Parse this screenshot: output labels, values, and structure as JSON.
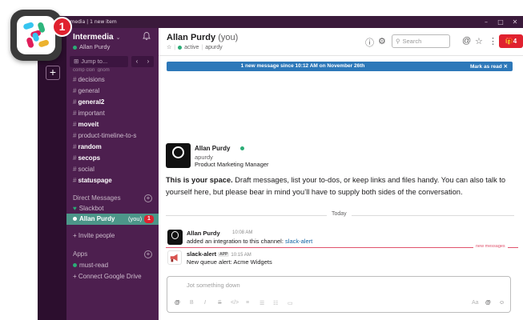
{
  "window": {
    "title": "ck | Intermedia | 1 new item",
    "controls": {
      "minimize": "–",
      "maximize": "□",
      "close": "✕"
    }
  },
  "app_icon": {
    "badge": "1",
    "icon": "slack-logo-icon"
  },
  "team_rail": {
    "add": "+"
  },
  "sidebar": {
    "team_name": "Intermedia",
    "team_caret": "⌄",
    "user": "Allan Purdy",
    "jump_to": "Jump to...",
    "channels_clipped": "comp clon_gnom",
    "channels": [
      {
        "label": "decisions",
        "bold": false
      },
      {
        "label": "general",
        "bold": false
      },
      {
        "label": "general2",
        "bold": true
      },
      {
        "label": "important",
        "bold": false
      },
      {
        "label": "moveit",
        "bold": true
      },
      {
        "label": "product-timeline-to-s",
        "bold": false
      },
      {
        "label": "random",
        "bold": true
      },
      {
        "label": "secops",
        "bold": true
      },
      {
        "label": "social",
        "bold": false
      },
      {
        "label": "statuspage",
        "bold": true
      }
    ],
    "dm_header": "Direct Messages",
    "dm_slackbot": "Slackbot",
    "dm_active": {
      "name": "Allan Purdy",
      "you": "(you)",
      "badge": "1"
    },
    "invite": "+ Invite people",
    "apps_header": "Apps",
    "app_item": "must-read",
    "connect": "+ Connect Google Drive"
  },
  "header": {
    "name": "Allan Purdy",
    "you": "(you)",
    "status": "active",
    "handle": "apurdy",
    "search_placeholder": "Search",
    "gift_count": "4",
    "icons": {
      "info": "ⓘ",
      "settings": "⚙",
      "mention": "@",
      "star": "☆",
      "more": "⋮"
    }
  },
  "banner": {
    "message": "1 new message since 10:12 AM on November 26th",
    "action": "Mark as read"
  },
  "intro": {
    "name": "Allan Purdy",
    "handle": "apurdy",
    "role": "Product Marketing Manager",
    "text_bold": "This is your space.",
    "text_rest": " Draft messages, list your to-dos, or keep links and files handy. You can also talk to yourself here, but please bear in mind you’ll have to supply both sides of the conversation."
  },
  "divider": {
    "label": "Today"
  },
  "messages": [
    {
      "author": "Allan Purdy",
      "time": "10:08 AM",
      "text": "added an integration to this channel:",
      "link": "slack-alert"
    },
    {
      "author": "slack-alert",
      "tag": "APP",
      "time": "10:15 AM",
      "text": "New queue alert: Acme Widgets"
    }
  ],
  "new_messages_label": "new messages",
  "composer": {
    "placeholder": "Jot something down",
    "tools": [
      "B",
      "I",
      "S",
      "</>",
      "≡",
      "☰",
      "☷",
      "▭"
    ],
    "right_tools": [
      "Aa",
      "@",
      "☺"
    ]
  }
}
